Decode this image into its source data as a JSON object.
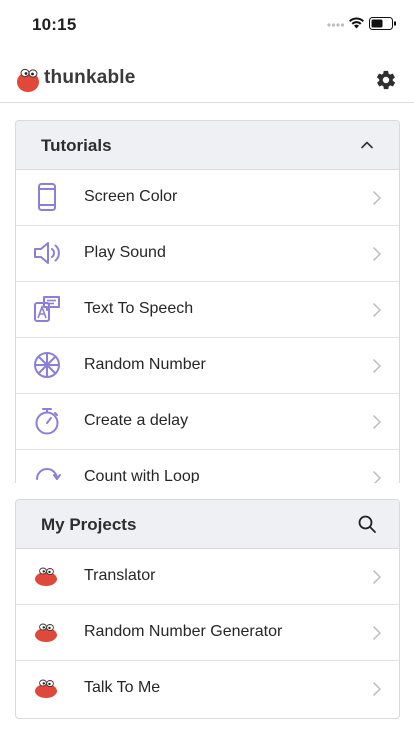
{
  "status": {
    "time": "10:15"
  },
  "header": {
    "brand": "thunkable"
  },
  "tutorials": {
    "title": "Tutorials",
    "items": [
      {
        "label": "Screen Color",
        "icon": "phone-screen-icon"
      },
      {
        "label": "Play Sound",
        "icon": "speaker-icon"
      },
      {
        "label": "Text To Speech",
        "icon": "text-to-speech-icon"
      },
      {
        "label": "Random Number",
        "icon": "wheel-icon"
      },
      {
        "label": "Create a delay",
        "icon": "stopwatch-icon"
      },
      {
        "label": "Count with Loop",
        "icon": "loop-icon"
      }
    ]
  },
  "projects": {
    "title": "My Projects",
    "items": [
      {
        "label": "Translator"
      },
      {
        "label": "Random Number Generator"
      },
      {
        "label": "Talk To Me"
      }
    ]
  },
  "colors": {
    "accent": "#8b7fd8",
    "brand_red": "#e0483a",
    "card_header": "#eff0f4"
  }
}
